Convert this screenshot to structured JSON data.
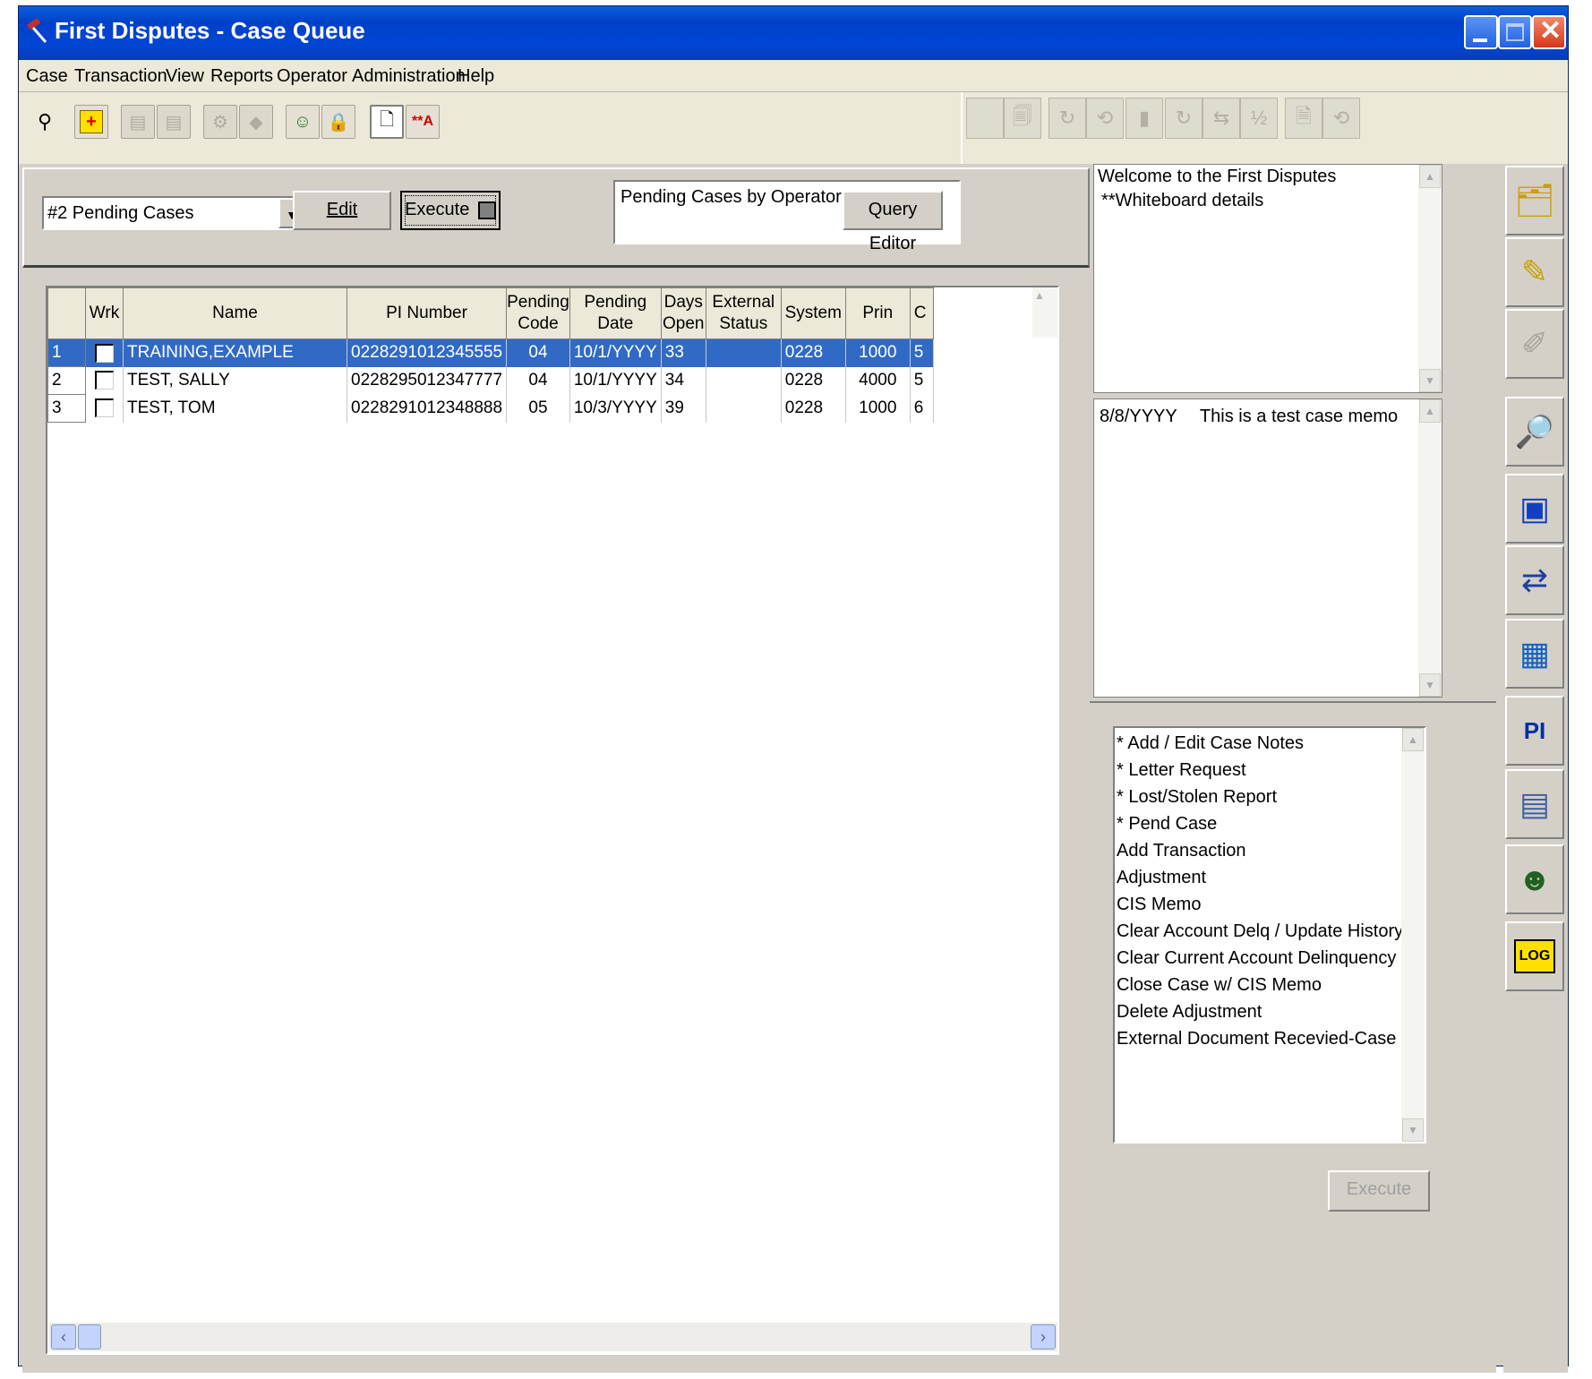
{
  "window": {
    "title": "First Disputes - Case Queue"
  },
  "menu": [
    "Case",
    "Transaction",
    "View",
    "Reports",
    "Operator",
    "Administration",
    "Help"
  ],
  "toolbar_left": [
    {
      "icon": "binoculars-icon",
      "glyph": "🔍",
      "enabled": true
    },
    {
      "icon": "new-case-icon",
      "glyph": "+",
      "enabled": true
    },
    {
      "icon": "folder-icon",
      "glyph": "▤",
      "enabled": false
    },
    {
      "icon": "folder-icon",
      "glyph": "▤",
      "enabled": false
    },
    {
      "icon": "gears-icon",
      "glyph": "⚙",
      "enabled": false
    },
    {
      "icon": "tag-icon",
      "glyph": "◆",
      "enabled": false
    },
    {
      "icon": "operators-icon",
      "glyph": "☺",
      "enabled": true
    },
    {
      "icon": "lock-icon",
      "glyph": "🔒",
      "enabled": true
    },
    {
      "icon": "preview-icon",
      "glyph": "🗎",
      "enabled": true
    },
    {
      "icon": "font-icon",
      "glyph": "A",
      "enabled": true
    }
  ],
  "query": {
    "selected": "#2 Pending Cases",
    "edit_label": "Edit",
    "execute_label": "Execute",
    "description": "Pending Cases by Operator",
    "query_editor_label": "Query Editor"
  },
  "grid": {
    "columns": [
      "",
      "Wrk",
      "Name",
      "PI Number",
      "Pending Code",
      "Pending Date",
      "Days Open",
      "External Status",
      "System",
      "Prin",
      "C"
    ],
    "rows": [
      {
        "num": "1",
        "name": "TRAINING,EXAMPLE",
        "pi": "0228291012345555",
        "code": "04",
        "date": "10/1/YYYY",
        "days": "33",
        "ext": "",
        "system": "0228",
        "prin": "1000",
        "c": "5"
      },
      {
        "num": "2",
        "name": "TEST, SALLY",
        "pi": "0228295012347777",
        "code": "04",
        "date": "10/1/YYYY",
        "days": "34",
        "ext": "",
        "system": "0228",
        "prin": "4000",
        "c": "5"
      },
      {
        "num": "3",
        "name": "TEST, TOM",
        "pi": "0228291012348888",
        "code": "05",
        "date": "10/3/YYYY",
        "days": "39",
        "ext": "",
        "system": "0228",
        "prin": "1000",
        "c": "6"
      }
    ],
    "selected_row": 0
  },
  "whiteboard": {
    "line1": "Welcome to the  First Disputes",
    "line2": "**Whiteboard details"
  },
  "memo": {
    "date": "8/8/YYYY",
    "text": "This is a test case memo"
  },
  "actions": {
    "items": [
      "* Add / Edit Case Notes",
      "* Letter Request",
      "* Lost/Stolen Report",
      "* Pend Case",
      "Add Transaction",
      "Adjustment",
      "CIS Memo",
      "Clear Account Delq / Update History",
      "Clear Current Account Delinquency",
      "Close Case w/ CIS Memo",
      "Delete Adjustment",
      "External Document Recevied-Case"
    ],
    "execute_label": "Execute"
  },
  "side_tools": [
    {
      "icon": "cases-stack-icon",
      "glyph": "🗂"
    },
    {
      "icon": "edit-card-icon",
      "glyph": "✎"
    },
    {
      "icon": "disabled-pen-icon",
      "glyph": "✐"
    },
    {
      "icon": "search-document-icon",
      "glyph": "🔎"
    },
    {
      "icon": "customer-view-icon",
      "glyph": "👤"
    },
    {
      "icon": "transfer-icon",
      "glyph": "⇄"
    },
    {
      "icon": "calendar-icon",
      "glyph": "📅"
    },
    {
      "icon": "pi-document-icon",
      "glyph": "PI"
    },
    {
      "icon": "forms-icon",
      "glyph": "▦"
    },
    {
      "icon": "operator-card-icon",
      "glyph": "☻"
    },
    {
      "icon": "log-icon",
      "glyph": "LOG"
    }
  ]
}
